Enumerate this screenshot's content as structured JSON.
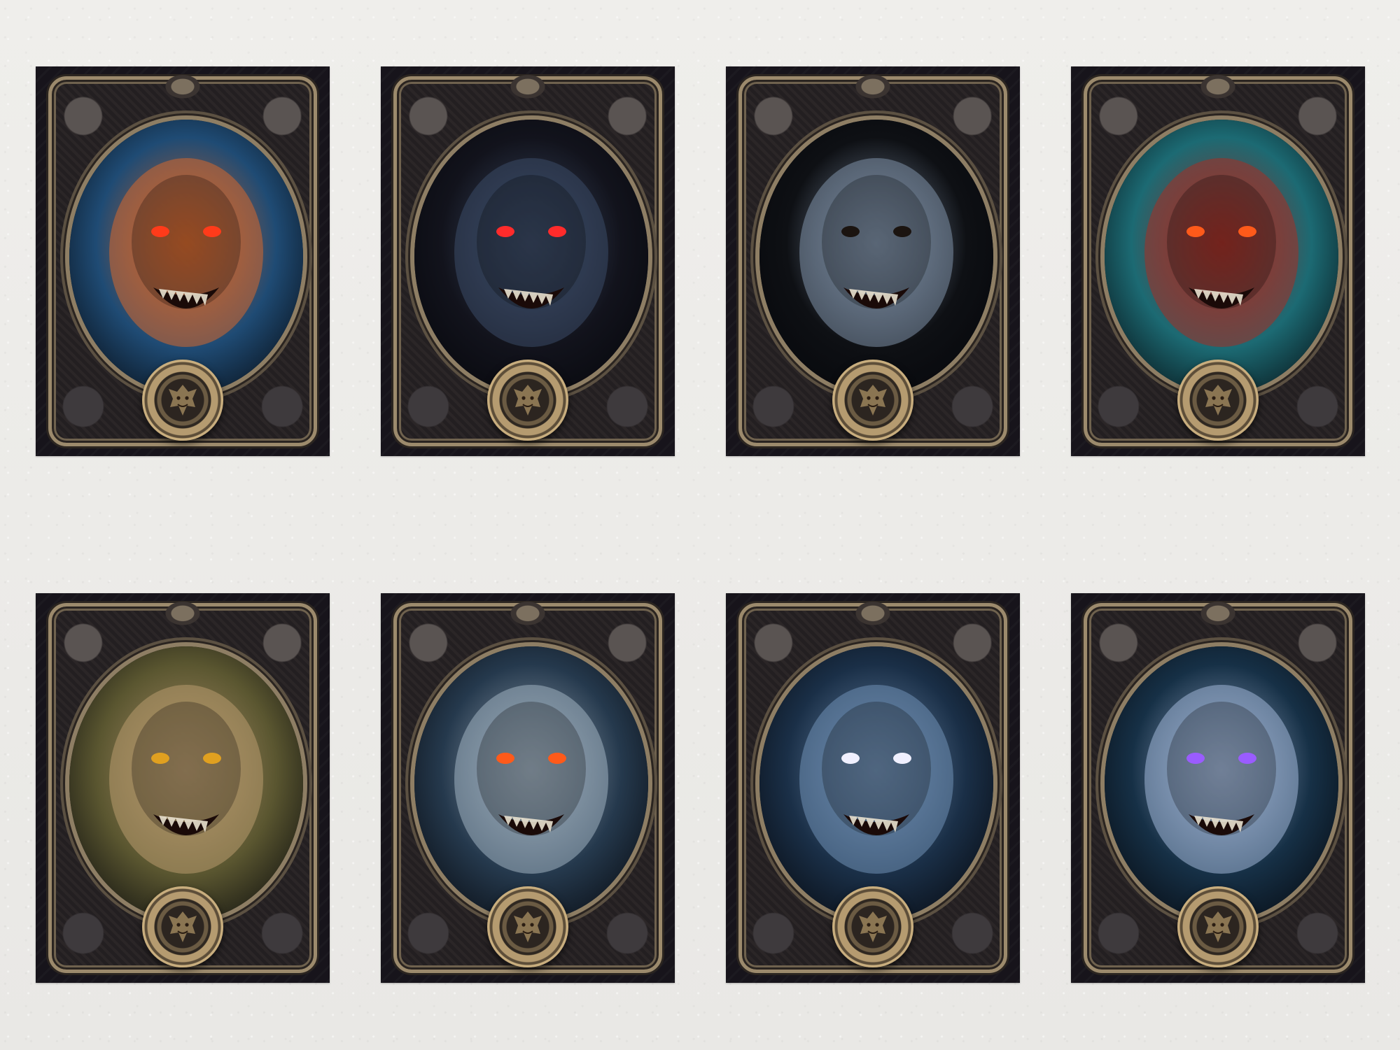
{
  "cards": [
    {
      "name": "dragon-card",
      "portrait": "dragon-portrait",
      "bg": "#1f4b74",
      "accent": "#d4682e",
      "eyes": "#ff3b1a"
    },
    {
      "name": "vampire-card",
      "portrait": "vampire-portrait",
      "bg": "#12131c",
      "accent": "#3a4a66",
      "eyes": "#ff2b2b"
    },
    {
      "name": "mummy-card",
      "portrait": "mummy-portrait",
      "bg": "#0e1014",
      "accent": "#7d8fa6",
      "eyes": "#1b1410"
    },
    {
      "name": "demon-card",
      "portrait": "demon-portrait",
      "bg": "#1c6a73",
      "accent": "#a23027",
      "eyes": "#ff5a1a"
    },
    {
      "name": "goblin-card",
      "portrait": "goblin-portrait",
      "bg": "#5a5630",
      "accent": "#b89b6e",
      "eyes": "#e0a020"
    },
    {
      "name": "ghoul-card",
      "portrait": "ghoul-portrait",
      "bg": "#25394d",
      "accent": "#9fb0c0",
      "eyes": "#ff5a1a"
    },
    {
      "name": "werewolf-card",
      "portrait": "werewolf-portrait",
      "bg": "#1a2f47",
      "accent": "#6f8fb4",
      "eyes": "#f0f0ff"
    },
    {
      "name": "witch-card",
      "portrait": "witch-portrait",
      "bg": "#163046",
      "accent": "#9fb5d6",
      "eyes": "#9a5cff"
    }
  ]
}
